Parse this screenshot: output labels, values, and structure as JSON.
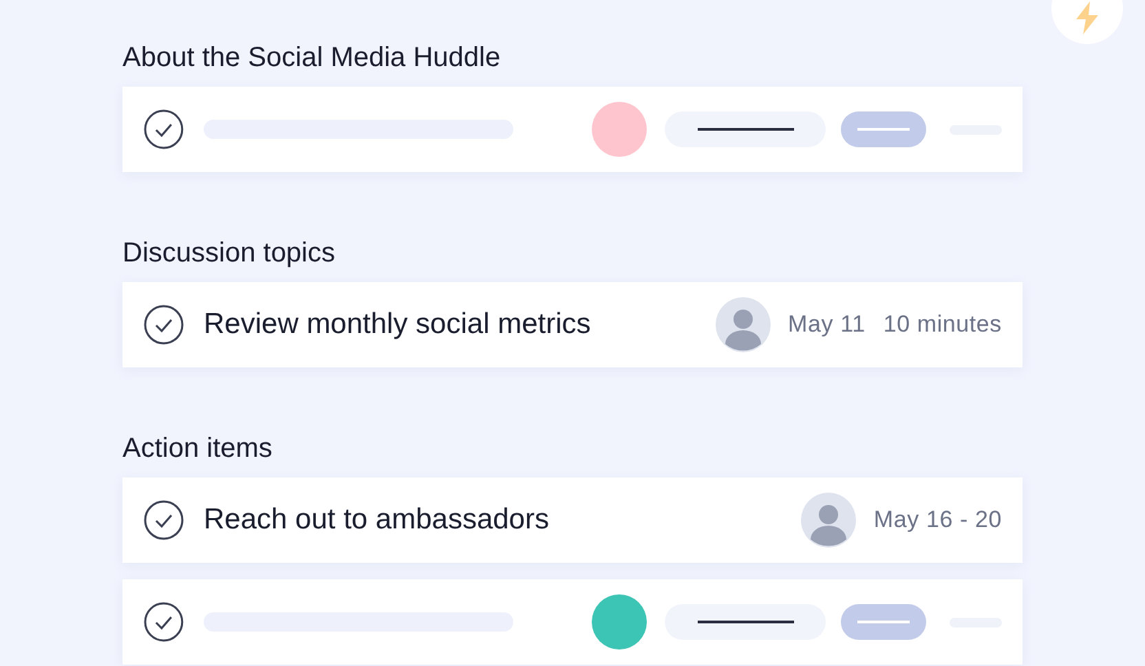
{
  "sections": [
    {
      "title": "About the Social Media Huddle",
      "rows": [
        {
          "kind": "placeholder",
          "color": "#fec5cf"
        }
      ]
    },
    {
      "title": "Discussion topics",
      "rows": [
        {
          "kind": "task",
          "label": "Review monthly social metrics",
          "date": "May 11",
          "duration": "10 minutes"
        }
      ]
    },
    {
      "title": "Action items",
      "rows": [
        {
          "kind": "task",
          "label": "Reach out to ambassadors",
          "date": "May 16 - 20"
        },
        {
          "kind": "placeholder",
          "color": "#3cc4b4"
        }
      ]
    }
  ]
}
